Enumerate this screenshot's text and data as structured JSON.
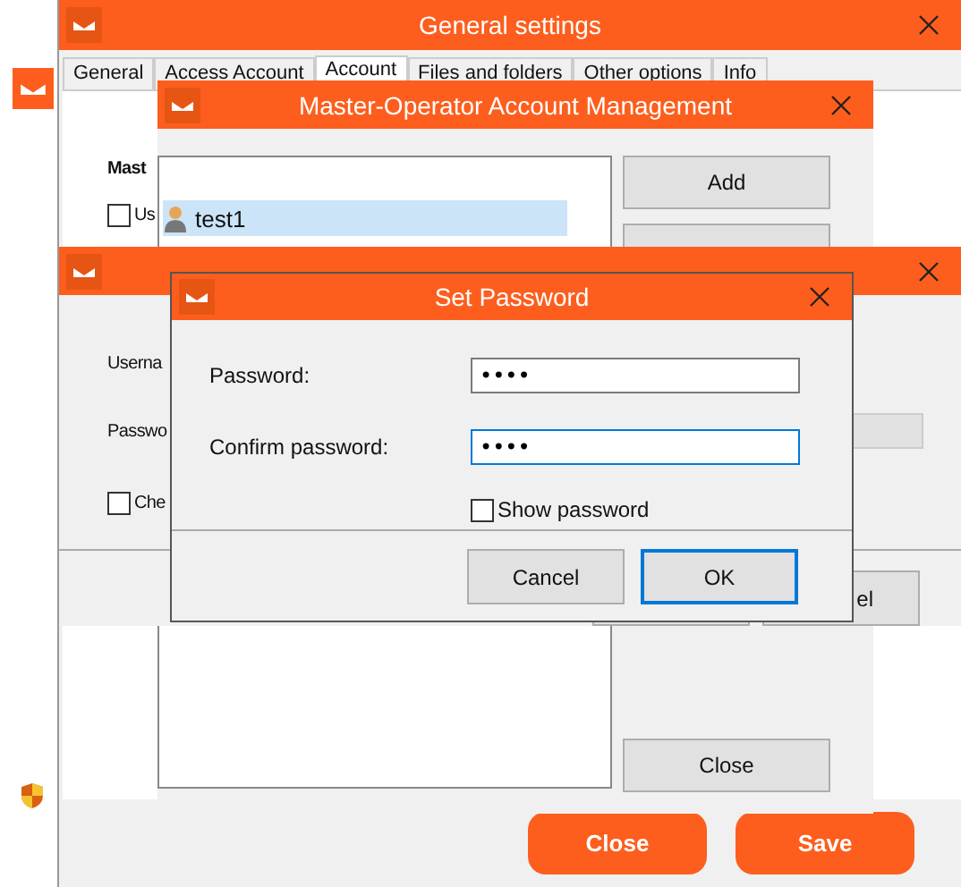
{
  "general_settings": {
    "title": "General settings",
    "tabs": [
      {
        "label": "General",
        "selected": false
      },
      {
        "label": "Access Account",
        "selected": false
      },
      {
        "label": "Account",
        "selected": true
      },
      {
        "label": "Files and folders",
        "selected": false
      },
      {
        "label": "Other options",
        "selected": false
      },
      {
        "label": "Info",
        "selected": false
      }
    ],
    "section_heading": "Mast",
    "checkbox": {
      "label": "Us",
      "checked": false
    },
    "buttons": [
      {
        "label": "Close"
      },
      {
        "label": "Save"
      }
    ]
  },
  "account_list_window": {
    "title": "Master-Operator Account Management",
    "users": [
      {
        "name": "test1",
        "selected": true
      }
    ],
    "buttons": [
      {
        "label": "Add"
      },
      {
        "label": "Close"
      }
    ]
  },
  "account_window": {
    "fields": [
      {
        "label": "Userna"
      },
      {
        "label": "Passwo"
      }
    ],
    "checkbox": {
      "label": "Che",
      "checked": false
    },
    "cancel_button": "el"
  },
  "set_password": {
    "title": "Set Password",
    "fields": [
      {
        "label": "Password:",
        "value": "••••",
        "focused": false
      },
      {
        "label": "Confirm password:",
        "value": "••••",
        "focused": true
      }
    ],
    "show_password": {
      "label": "Show password",
      "checked": false
    },
    "buttons": [
      {
        "label": "Cancel",
        "default": false
      },
      {
        "label": "OK",
        "default": true
      }
    ]
  }
}
